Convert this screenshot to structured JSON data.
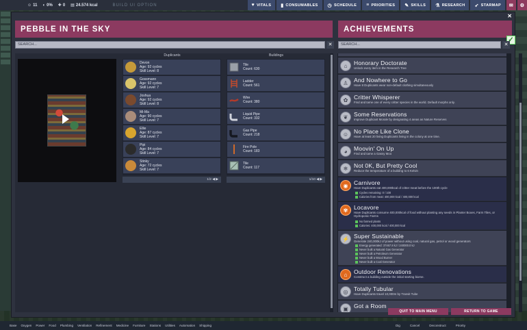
{
  "topbar": {
    "resources": [
      "11",
      "0%",
      "0",
      "24.574 kcal"
    ],
    "build_label": "BUILD UI OPTION",
    "tabs": [
      {
        "icon": "heart-icon",
        "label": "VITALS"
      },
      {
        "icon": "pill-icon",
        "label": "CONSUMABLES"
      },
      {
        "icon": "clock-icon",
        "label": "SCHEDULE"
      },
      {
        "icon": "list-icon",
        "label": "PRIORITIES"
      },
      {
        "icon": "wrench-icon",
        "label": "SKILLS"
      },
      {
        "icon": "flask-icon",
        "label": "RESEARCH"
      },
      {
        "icon": "rocket-icon",
        "label": "STARMAP"
      }
    ]
  },
  "left_panel": {
    "title": "PEBBLE IN THE SKY",
    "search_placeholder": "SEARCH...",
    "duplicants_header": "Duplicants",
    "buildings_header": "Buildings",
    "duplicants": [
      {
        "name": "Devon",
        "age": "Age: 92 cycles",
        "skill": "Skill Level: 8",
        "color": "#c59a3a"
      },
      {
        "name": "Gossmann",
        "age": "Age: 92 cycles",
        "skill": "Skill Level: 7",
        "color": "#d9c46a"
      },
      {
        "name": "Joshua",
        "age": "Age: 92 cycles",
        "skill": "Skill Level: 8",
        "color": "#7a4a2e"
      },
      {
        "name": "Mi-Ma",
        "age": "Age: 90 cycles",
        "skill": "Skill Level: 7",
        "color": "#a98c7a"
      },
      {
        "name": "Ellie",
        "age": "Age: 87 cycles",
        "skill": "Skill Level: 7",
        "color": "#d8a52e"
      },
      {
        "name": "Pipi",
        "age": "Age: 84 cycles",
        "skill": "Skill Level: 7",
        "color": "#2b2b2b"
      },
      {
        "name": "Stinky",
        "age": "Age: 72 cycles",
        "skill": "Skill Level: 7",
        "color": "#c98a3a"
      }
    ],
    "buildings": [
      {
        "name": "Tile",
        "count": "Count: 630",
        "icon": "tile-icon"
      },
      {
        "name": "Ladder",
        "count": "Count: 561",
        "icon": "ladder-icon"
      },
      {
        "name": "Wire",
        "count": "Count: 380",
        "icon": "wire-icon"
      },
      {
        "name": "Liquid Pipe",
        "count": "Count: 332",
        "icon": "liquid-pipe-icon"
      },
      {
        "name": "Gas Pipe",
        "count": "Count: 218",
        "icon": "gas-pipe-icon"
      },
      {
        "name": "Fire Pole",
        "count": "Count: 183",
        "icon": "fire-pole-icon"
      },
      {
        "name": "Tile",
        "count": "Count: 117",
        "icon": "tile2-icon"
      }
    ],
    "dup_pager": "1/2",
    "bld_pager": "1/10"
  },
  "right_panel": {
    "title": "ACHIEVEMENTS",
    "search_placeholder": "SEARCH...",
    "achievements": [
      {
        "name": "Honorary Doctorate",
        "desc": "Unlock every item in the Research Tree",
        "done": false,
        "reqs": []
      },
      {
        "name": "And Nowhere to Go",
        "desc": "Have 8 Duplicants wear non-default clothing simultaneously",
        "done": false,
        "reqs": []
      },
      {
        "name": "Critter Whisperer",
        "desc": "Find and tame one of every critter species in the world. Default morphs only.",
        "done": false,
        "reqs": []
      },
      {
        "name": "Some Reservations",
        "desc": "Improve Duplicant Morale by designating 4 areas as Nature Reserves",
        "done": false,
        "reqs": []
      },
      {
        "name": "No Place Like Clone",
        "desc": "Have at least 20 living Duplicants living in the colony at one time.",
        "done": false,
        "reqs": []
      },
      {
        "name": "Moovin' On Up",
        "desc": "Find and tame a Gassy Moo",
        "done": false,
        "reqs": []
      },
      {
        "name": "Not 0K, But Pretty Cool",
        "desc": "Reduce the temperature of a building to 6 Kelvin",
        "done": false,
        "reqs": []
      },
      {
        "name": "Carnivore",
        "desc": "Have Duplicants eat 400,000kcal of critter meat before the 100th cycle",
        "done": true,
        "reqs": [
          "Cycles remaining: 0 / 100",
          "Calories from meat: 400,000 kcal / 400,000 kcal"
        ]
      },
      {
        "name": "Locavore",
        "desc": "Have Duplicants consume 400,000kcal of food without planting any seeds in Planter Boxes, Farm Tiles, or Hydroponic Farms",
        "done": true,
        "reqs": [
          "No farmed plants",
          "Calories: 400,000 kcal / 400,000 kcal"
        ]
      },
      {
        "name": "Super Sustainable",
        "desc": "Generate 240,000kJ of power without using coal, natural gas, petrol or wood generators",
        "done": false,
        "reqs": [
          "Energy generated: 37467.8 kJ / 240000.0 kJ",
          "Never built a Natural Gas Generator",
          "Never built a Petroleum Generator",
          "Never built a Wood Burner",
          "Never built a Coal Generator"
        ]
      },
      {
        "name": "Outdoor Renovations",
        "desc": "Construct a building outside the initial starting biome.",
        "done": true,
        "reqs": []
      },
      {
        "name": "Totally Tubular",
        "desc": "Have Duplicants travel 10,000m by Transit Tube",
        "done": false,
        "reqs": []
      },
      {
        "name": "Got a Room",
        "desc": "",
        "done": false,
        "reqs": []
      }
    ]
  },
  "footer": {
    "main_menu": "QUIT TO MAIN MENU",
    "return": "RETURN TO GAME"
  },
  "bottombar": {
    "categories": [
      "Base",
      "Oxygen",
      "Power",
      "Food",
      "Plumbing",
      "Ventilation",
      "Refinement",
      "Medicine",
      "Furniture",
      "Stations",
      "Utilities",
      "Automation",
      "Shipping"
    ],
    "right_tools": [
      "Dig",
      "Cancel",
      "Deconstruct",
      "Priority"
    ]
  }
}
